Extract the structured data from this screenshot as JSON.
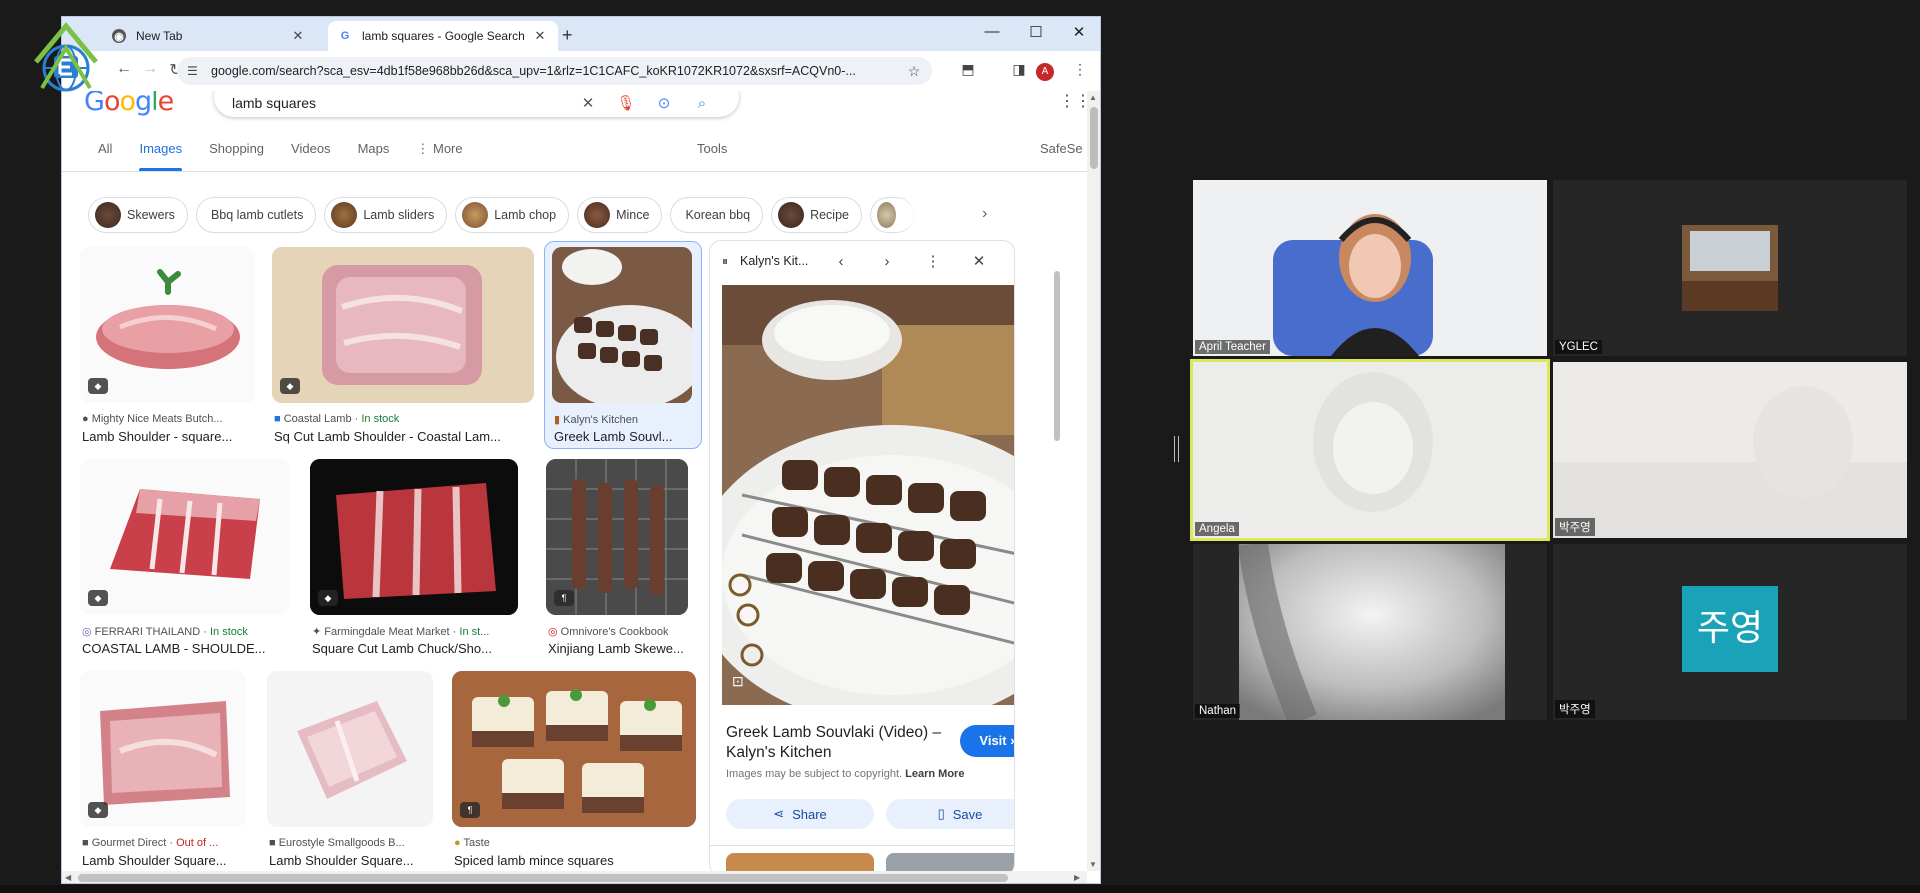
{
  "browser": {
    "tabs": [
      {
        "title": "New Tab",
        "icon": "chrome-icon"
      },
      {
        "title": "lamb squares - Google Search",
        "icon": "google-g-icon"
      }
    ],
    "url": "google.com/search?sca_esv=4db1f58e968bb26d&sca_upv=1&rlz=1C1CAFC_koKR1072KR1072&sxsrf=ACQVn0-...",
    "profile_initial": "A"
  },
  "google": {
    "logo": [
      "G",
      "o",
      "o",
      "g",
      "l",
      "e"
    ],
    "query": "lamb squares",
    "nav": {
      "all": "All",
      "images": "Images",
      "shopping": "Shopping",
      "videos": "Videos",
      "maps": "Maps",
      "more": "More",
      "tools": "Tools",
      "safesearch": "SafeSe"
    },
    "chips": [
      "Skewers",
      "Bbq lamb cutlets",
      "Lamb sliders",
      "Lamb chop",
      "Mince",
      "Korean bbq",
      "Recipe"
    ],
    "results": [
      {
        "source": "Mighty Nice Meats Butch...",
        "stock": "",
        "title": "Lamb Shoulder - square..."
      },
      {
        "source": "Coastal Lamb",
        "stock": "In stock",
        "title": "Sq Cut Lamb Shoulder - Coastal Lam..."
      },
      {
        "source": "Kalyn's Kitchen",
        "stock": "",
        "title": "Greek Lamb Souvl..."
      },
      {
        "source": "FERRARI THAILAND",
        "stock": "In stock",
        "title": "COASTAL LAMB - SHOULDE..."
      },
      {
        "source": "Farmingdale Meat Market",
        "stock": "In st...",
        "title": "Square Cut Lamb Chuck/Sho..."
      },
      {
        "source": "Omnivore's Cookbook",
        "stock": "",
        "title": "Xinjiang Lamb Skewe..."
      },
      {
        "source": "Gourmet Direct",
        "stock": "Out of ...",
        "title": "Lamb Shoulder Square..."
      },
      {
        "source": "Eurostyle Smallgoods B...",
        "stock": "",
        "title": "Lamb Shoulder Square..."
      },
      {
        "source": "Taste",
        "stock": "",
        "title": "Spiced lamb mince squares"
      }
    ],
    "panel": {
      "site": "Kalyn's Kit...",
      "title": "Greek Lamb Souvlaki (Video) – Kalyn's Kitchen",
      "visit": "Visit",
      "copyright": "Images may be subject to copyright.",
      "learn_more": "Learn More",
      "share": "Share",
      "save": "Save"
    }
  },
  "meeting": {
    "participants": [
      {
        "name": "April Teacher"
      },
      {
        "name": "YGLEC"
      },
      {
        "name": "Angela"
      },
      {
        "name": "박주영"
      },
      {
        "name": "Nathan"
      },
      {
        "name": "박주영",
        "avatar_text": "주영"
      }
    ]
  },
  "colors": {
    "accent": "#1a73e8",
    "speaker_border": "#dbe85a",
    "avatar_bg": "#1aa3b8"
  }
}
